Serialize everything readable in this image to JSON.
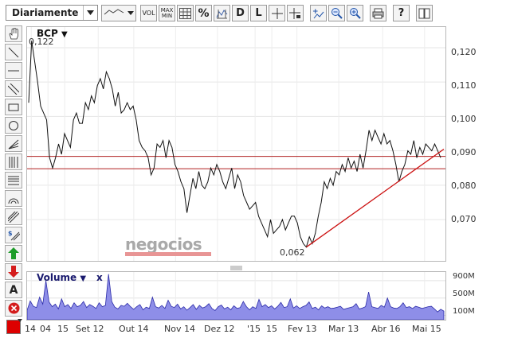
{
  "toolbar": {
    "period_select": "Diariamente",
    "buttons": {
      "vol": "VOL",
      "max": "MAX",
      "min": "MIN",
      "percent": "%",
      "d": "D",
      "l": "L"
    }
  },
  "chart": {
    "symbol": "BCP",
    "symbol_dropdown": "▼",
    "max_label": "0,122",
    "min_label": "0,062",
    "watermark": "negocios",
    "y_ticks": [
      "0,120",
      "0,110",
      "0,100",
      "0,090",
      "0,080",
      "0,070"
    ],
    "x_ticks": [
      "14",
      "04",
      "15",
      "Set 12",
      "Out 14",
      "Nov 14",
      "Dez 12",
      "'15",
      "15",
      "Fev 13",
      "Mar 13",
      "Abr 16",
      "Mai 15"
    ]
  },
  "volume": {
    "title": "Volume",
    "dropdown": "▼",
    "close": "x",
    "y_ticks": [
      "900M",
      "500M",
      "100M"
    ]
  },
  "chart_data": [
    {
      "type": "line",
      "series": [
        {
          "name": "BCP",
          "values": [
            0.104,
            0.122,
            0.116,
            0.11,
            0.103,
            0.101,
            0.099,
            0.088,
            0.085,
            0.088,
            0.092,
            0.089,
            0.095,
            0.093,
            0.091,
            0.099,
            0.101,
            0.098,
            0.098,
            0.104,
            0.102,
            0.106,
            0.104,
            0.109,
            0.111,
            0.108,
            0.113,
            0.111,
            0.108,
            0.103,
            0.107,
            0.101,
            0.102,
            0.104,
            0.102,
            0.103,
            0.099,
            0.093,
            0.091,
            0.09,
            0.088,
            0.083,
            0.085,
            0.092,
            0.091,
            0.093,
            0.088,
            0.093,
            0.091,
            0.086,
            0.084,
            0.081,
            0.079,
            0.072,
            0.077,
            0.082,
            0.079,
            0.084,
            0.08,
            0.079,
            0.081,
            0.085,
            0.083,
            0.086,
            0.084,
            0.081,
            0.079,
            0.082,
            0.085,
            0.079,
            0.083,
            0.081,
            0.077,
            0.075,
            0.073,
            0.074,
            0.075,
            0.071,
            0.069,
            0.067,
            0.065,
            0.07,
            0.066,
            0.067,
            0.068,
            0.07,
            0.067,
            0.069,
            0.071,
            0.071,
            0.069,
            0.065,
            0.063,
            0.062,
            0.065,
            0.063,
            0.066,
            0.071,
            0.075,
            0.081,
            0.079,
            0.082,
            0.08,
            0.084,
            0.083,
            0.086,
            0.084,
            0.088,
            0.085,
            0.087,
            0.084,
            0.089,
            0.085,
            0.09,
            0.096,
            0.093,
            0.096,
            0.094,
            0.092,
            0.095,
            0.092,
            0.093,
            0.09,
            0.086,
            0.081,
            0.084,
            0.086,
            0.09,
            0.089,
            0.093,
            0.088,
            0.091,
            0.089,
            0.092,
            0.091,
            0.09,
            0.092,
            0.09,
            0.088
          ]
        }
      ],
      "ylim": [
        0.058,
        0.126
      ],
      "grid": true,
      "support_lines": [
        0.0884,
        0.0848
      ],
      "trend_line": {
        "start": 0.062,
        "end": 0.0905
      }
    },
    {
      "type": "area",
      "series": [
        {
          "name": "Volume",
          "values": [
            220,
            430,
            310,
            280,
            520,
            360,
            900,
            410,
            300,
            360,
            250,
            480,
            300,
            350,
            260,
            390,
            300,
            330,
            420,
            280,
            350,
            310,
            260,
            390,
            300,
            330,
            1050,
            420,
            290,
            250,
            330,
            310,
            380,
            300,
            240,
            300,
            350,
            230,
            290,
            260,
            520,
            300,
            270,
            330,
            260,
            450,
            310,
            280,
            360,
            250,
            300,
            220,
            280,
            350,
            240,
            330,
            270,
            300,
            370,
            260,
            210,
            300,
            340,
            250,
            290,
            230,
            320,
            260,
            280,
            420,
            300,
            230,
            300,
            260,
            470,
            300,
            350,
            280,
            320,
            250,
            310,
            400,
            280,
            300,
            480,
            270,
            320,
            260,
            300,
            330,
            410,
            260,
            290,
            230,
            320,
            270,
            300,
            260,
            270,
            290,
            310,
            240,
            260,
            280,
            300,
            370,
            250,
            270,
            300,
            640,
            300,
            280,
            260,
            330,
            290,
            500,
            300,
            270,
            260,
            300,
            390,
            280,
            300,
            260,
            310,
            290,
            260,
            280,
            300,
            310,
            250,
            180,
            240,
            200
          ]
        }
      ],
      "ylim": [
        0,
        1100
      ]
    }
  ]
}
